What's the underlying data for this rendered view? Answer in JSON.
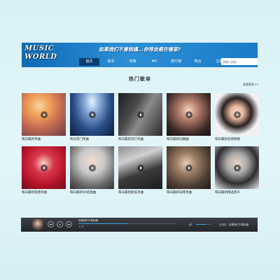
{
  "header": {
    "logo_line1": "MUSIC",
    "logo_line2": "WORLD",
    "slogan": "如果我们不曾相遇...你将会是在哪里?",
    "nav": [
      "首页",
      "歌手",
      "专辑",
      "MV",
      "排行榜",
      "电台",
      "注册"
    ],
    "search_placeholder": "请输入搜索",
    "search_button": "搜索"
  },
  "main": {
    "section_title": "热门歌单",
    "more_link": "查看更多>>",
    "playlists": [
      "每日最新单曲",
      "每日热门单曲",
      "每日最新流行单曲",
      "每日最新DJ舞曲",
      "每日最新伤感情歌",
      "每日最新刺激单曲",
      "每日最新90后歌曲",
      "每日最新欧美单曲",
      "每日最新日韩单曲",
      "每日最新精选原声"
    ]
  },
  "player": {
    "track_title": "如果我们不曾相遇",
    "time_elapsed": "1:13",
    "playlist_text": "五月天 - 如果我们不曾相遇",
    "progress": 0.5,
    "volume": 0.7,
    "prev_icon": "⏮",
    "pause_icon": "⏸",
    "next_icon": "⏭",
    "volume_icon": "🔊"
  },
  "colors": {
    "header_blue": "#1a7cc8",
    "nav_active": "#0a3f73",
    "player_bg": "#2b2e33",
    "accent": "#3aa3e3"
  }
}
